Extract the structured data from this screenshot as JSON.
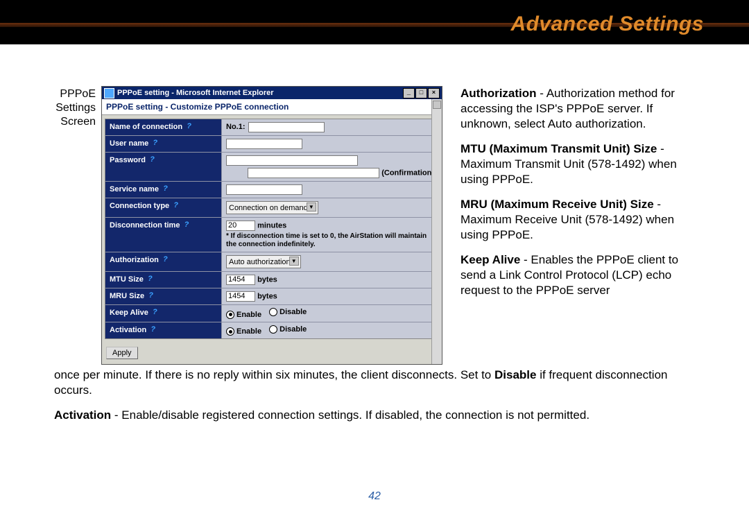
{
  "title": "Advanced Settings",
  "left_label": [
    "PPPoE",
    "Settings",
    "Screen"
  ],
  "window": {
    "title": "PPPoE setting - Microsoft Internet Explorer",
    "subtitle": "PPPoE setting - Customize PPPoE connection"
  },
  "form": {
    "name_of_connection": {
      "label": "Name of connection",
      "prefix": "No.1:"
    },
    "user_name": {
      "label": "User name"
    },
    "password": {
      "label": "Password",
      "confirmation": "(Confirmation)"
    },
    "service_name": {
      "label": "Service name"
    },
    "connection_type": {
      "label": "Connection type",
      "value": "Connection on demand"
    },
    "disconnection_time": {
      "label": "Disconnection time",
      "value": "20",
      "unit": "minutes",
      "note": "* If disconnection time is set to 0, the AirStation will maintain the connection indefinitely."
    },
    "authorization": {
      "label": "Authorization",
      "value": "Auto authorization"
    },
    "mtu_size": {
      "label": "MTU Size",
      "value": "1454",
      "unit": "bytes"
    },
    "mru_size": {
      "label": "MRU Size",
      "value": "1454",
      "unit": "bytes"
    },
    "keep_alive": {
      "label": "Keep Alive",
      "enable": "Enable",
      "disable": "Disable"
    },
    "activation": {
      "label": "Activation",
      "enable": "Enable",
      "disable": "Disable"
    },
    "apply": "Apply"
  },
  "right": {
    "p1_b": "Authorization",
    "p1": " - Authorization method for accessing the ISP's PPPoE server.  If unknown, select Auto authorization.",
    "p2_b": "MTU (Maximum Transmit Unit) Size",
    "p2": " - Maximum Transmit Unit (578-1492) when using PPPoE.",
    "p3_b": "MRU (Maximum Receive Unit) Size",
    "p3": " - Maximum Receive Unit (578-1492) when using PPPoE.",
    "p4_b": "Keep Alive",
    "p4": " - Enables the PPPoE client to send a Link Control Protocol (LCP) echo request to the PPPoE server"
  },
  "bottom": {
    "p1a": "once per minute.  If there is no reply within six minutes, the client disconnects.  Set to ",
    "p1b": "Disable",
    "p1c": " if frequent disconnection occurs.",
    "p2b": "Activation",
    "p2": " - Enable/disable registered connection settings. If disabled, the connection is not permitted."
  },
  "page_num": "42"
}
